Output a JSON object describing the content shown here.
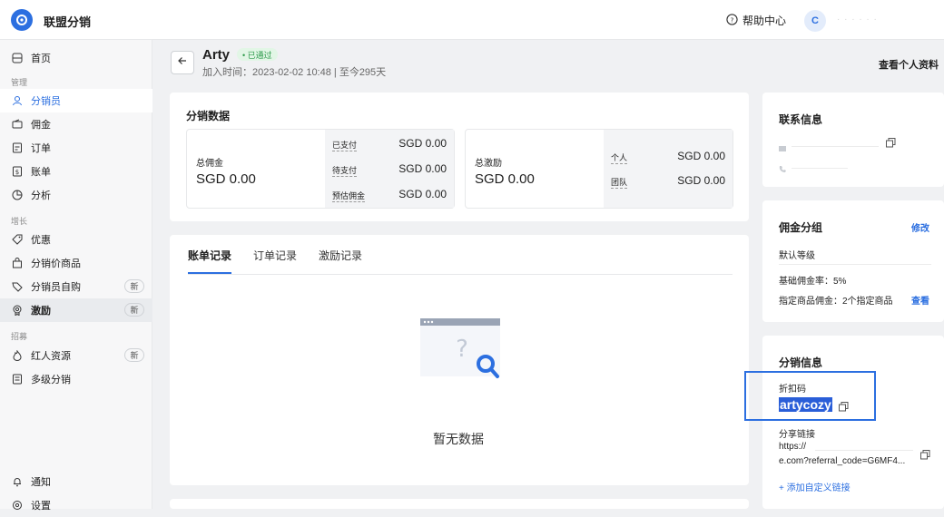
{
  "app": {
    "brand": "联盟分销",
    "help": "帮助中心",
    "avatar_letter": "C",
    "user_masked": "· · · · · ·"
  },
  "sidebar": {
    "home": "首页",
    "section_manage": "管理",
    "items_manage": [
      "分销员",
      "佣金",
      "订单",
      "账单",
      "分析"
    ],
    "section_growth": "增长",
    "items_growth": [
      "优惠",
      "分销价商品",
      "分销员自购",
      "激励"
    ],
    "section_recruit": "招募",
    "items_recruit": [
      "红人资源",
      "多级分销"
    ],
    "badge_new": "新",
    "notify": "通知",
    "settings": "设置"
  },
  "header": {
    "name": "Arty",
    "status": "• 已通过",
    "joined": "加入时间：2023-02-02 10:48 | 至今295天",
    "view_profile": "查看个人资料"
  },
  "stats": {
    "title": "分销数据",
    "commission_label": "总佣金",
    "commission_value": "SGD 0.00",
    "commission_rows": [
      {
        "label": "已支付",
        "value": "SGD 0.00"
      },
      {
        "label": "待支付",
        "value": "SGD 0.00"
      },
      {
        "label": "预估佣金",
        "value": "SGD 0.00"
      }
    ],
    "incentive_label": "总激励",
    "incentive_value": "SGD 0.00",
    "incentive_rows": [
      {
        "label": "个人",
        "value": "SGD 0.00"
      },
      {
        "label": "团队",
        "value": "SGD 0.00"
      }
    ]
  },
  "records": {
    "tabs": [
      "账单记录",
      "订单记录",
      "激励记录"
    ],
    "empty": "暂无数据"
  },
  "contact": {
    "title": "联系信息"
  },
  "group": {
    "title": "佣金分组",
    "edit": "修改",
    "level": "默认等级",
    "base_rate": "基础佣金率：5%",
    "specified": "指定商品佣金：2个指定商品",
    "view": "查看"
  },
  "distribution": {
    "title": "分销信息",
    "code_label": "折扣码",
    "code": "artycozy",
    "share_label": "分享链接",
    "share_line1": "https://",
    "share_line2": "e.com?referral_code=G6MF4...",
    "add_link": "+ 添加自定义链接"
  },
  "colors": {
    "accent": "#2c6fe0",
    "success": "#2e9b4c",
    "selection": "#2a5ed8"
  }
}
